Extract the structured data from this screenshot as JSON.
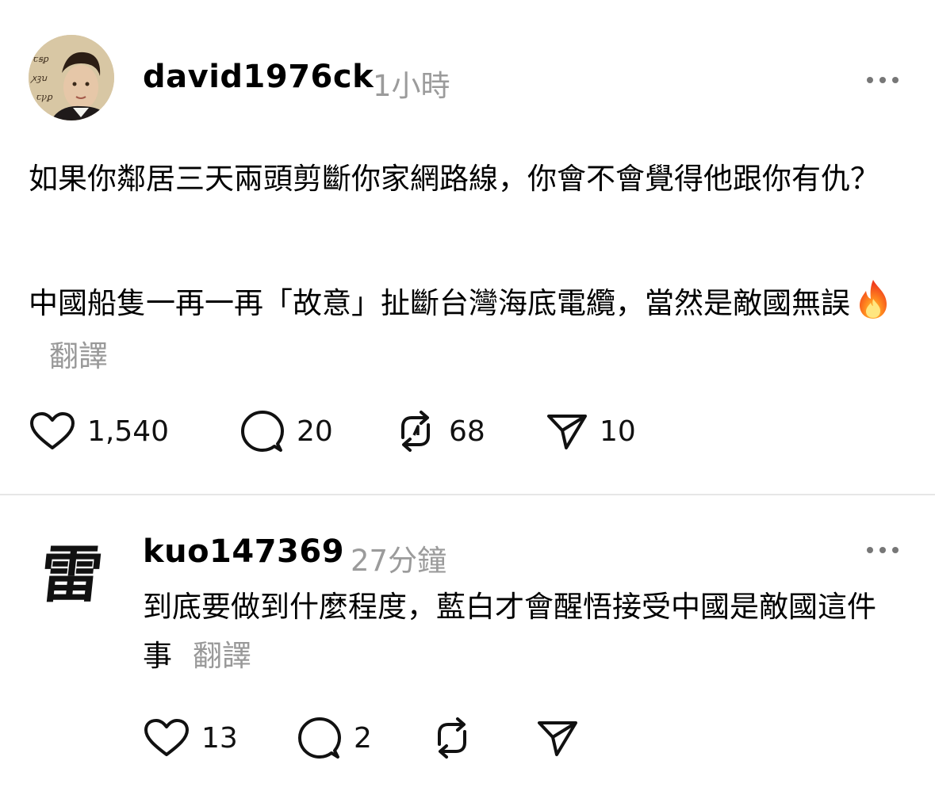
{
  "post": {
    "username": "david1976ck",
    "time": "1小時",
    "paragraph1": "如果你鄰居三天兩頭剪斷你家網路線，你會不會覺得他跟你有仇？",
    "paragraph2": "中國船隻一再一再「故意」扯斷台灣海底電纜，當然是敵國無誤",
    "translate_label": "翻譯",
    "avatar_script_text": "ꞇꞩꝑ ꭗꝫꭒ ꞇꝩꝑ",
    "counts": {
      "likes": "1,540",
      "comments": "20",
      "reposts": "68",
      "shares": "10"
    }
  },
  "reply": {
    "username": "kuo147369",
    "time": "27分鐘",
    "text": "到底要做到什麼程度，藍白才會醒悟接受中國是敵國這件事",
    "translate_label": "翻譯",
    "avatar_char": "雷",
    "counts": {
      "likes": "13",
      "comments": "2"
    }
  },
  "icons": [
    "heart-icon",
    "comment-icon",
    "repost-icon",
    "share-icon",
    "more-icon",
    "fire-emoji"
  ],
  "colors": {
    "muted": "#999999",
    "text": "#000000",
    "divider": "#e6e6e6"
  }
}
